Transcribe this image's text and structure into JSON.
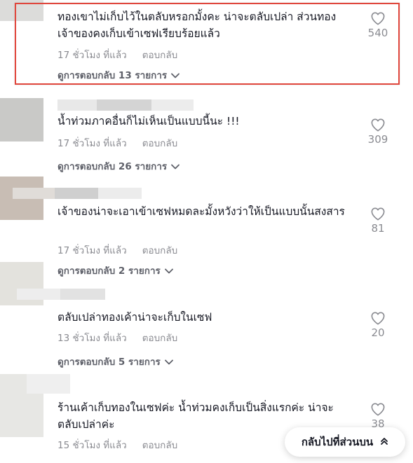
{
  "comments": [
    {
      "text": "ทองเขาไม่เก็บไว้ในตลับหรอกมั้งคะ น่าจะตลับเปล่า ส่วนทองเจ้าของคงเก็บเข้าเซฟเรียบร้อยแล้ว",
      "time": "17 ชั่วโมง ที่แล้ว",
      "reply": "ตอบกลับ",
      "view_replies": "ดูการตอบกลับ 13 รายการ",
      "likes": "540"
    },
    {
      "text": "น้ำท่วมภาคอื่นก็ไม่เห็นเป็นแบบนี้นะ !!!",
      "time": "17 ชั่วโมง ที่แล้ว",
      "reply": "ตอบกลับ",
      "view_replies": "ดูการตอบกลับ 26 รายการ",
      "likes": "309"
    },
    {
      "text": "เจ้าของน่าจะเอาเข้าเซฟหมดละมั้งหวังว่าให้เป็นแบบนั้นสงสาร",
      "time": "17 ชั่วโมง ที่แล้ว",
      "reply": "ตอบกลับ",
      "view_replies": "ดูการตอบกลับ 2 รายการ",
      "likes": "81"
    },
    {
      "text": "ตลับเปล่าทองเค้าน่าจะเก็บในเซฟ",
      "time": "13 ชั่วโมง ที่แล้ว",
      "reply": "ตอบกลับ",
      "view_replies": "ดูการตอบกลับ 5 รายการ",
      "likes": "20"
    },
    {
      "text": "ร้านเค้าเก็บทองในเซฟค่ะ น้ำท่วมคงเก็บเป็นสิ่งแรกค่ะ น่าจะตลับเปล่าค่ะ",
      "time": "15 ชั่วโมง ที่แล้ว",
      "reply": "ตอบกลับ",
      "likes": "38"
    }
  ],
  "back_to_top": "กลับไปที่ส่วนบน",
  "colors": {
    "highlight": "#e0463c",
    "muted": "#8a8b91"
  }
}
